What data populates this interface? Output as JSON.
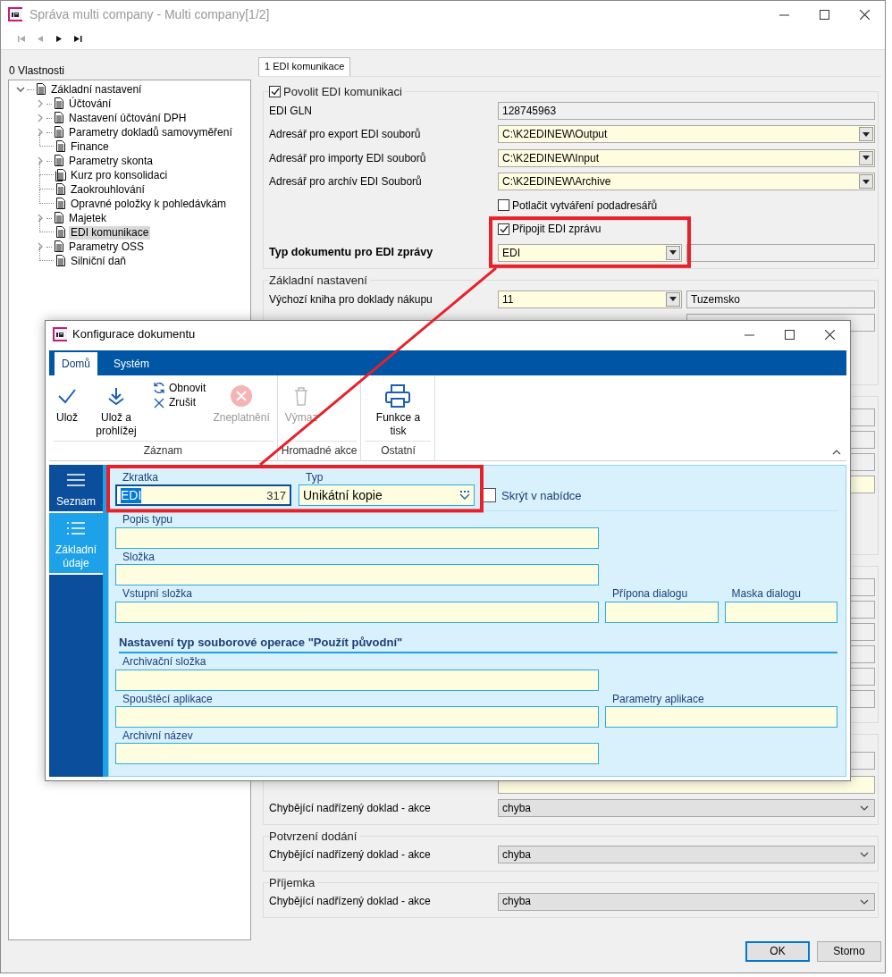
{
  "window": {
    "title": "Správa multi company - Multi company[1/2]"
  },
  "nav": [
    {
      "kind": "first",
      "disabled": true
    },
    {
      "kind": "prev",
      "disabled": true
    },
    {
      "kind": "next",
      "disabled": false
    },
    {
      "kind": "last",
      "disabled": false
    }
  ],
  "properties_label": "0 Vlastnosti",
  "tree": {
    "label": "Základní nastavení",
    "expanded": true,
    "children": [
      {
        "label": "Účtování",
        "kind": "group",
        "selected": false
      },
      {
        "label": "Nastavení účtování DPH",
        "kind": "group",
        "selected": false
      },
      {
        "label": "Parametry dokladů samovyměření",
        "kind": "group",
        "selected": false
      },
      {
        "label": "Finance",
        "kind": "leaf",
        "selected": false
      },
      {
        "label": "Parametry skonta",
        "kind": "group",
        "selected": false
      },
      {
        "label": "Kurz pro konsolidaci",
        "kind": "leaf-multi",
        "selected": false
      },
      {
        "label": "Zaokrouhlování",
        "kind": "leaf",
        "selected": false
      },
      {
        "label": "Opravné položky k pohledávkám",
        "kind": "leaf",
        "selected": false
      },
      {
        "label": "Majetek",
        "kind": "group",
        "selected": false
      },
      {
        "label": "EDI komunikace",
        "kind": "leaf",
        "selected": true
      },
      {
        "label": "Parametry OSS",
        "kind": "group",
        "selected": false
      },
      {
        "label": "Silniční daň",
        "kind": "leaf",
        "selected": false
      }
    ]
  },
  "tabs": [
    {
      "label": "1 EDI komunikace",
      "selected": true
    }
  ],
  "edi_group": {
    "label": "Povolit EDI komunikaci",
    "checked": true,
    "rows": [
      {
        "kind": "readonly",
        "label": "EDI GLN",
        "value": "128745963"
      },
      {
        "kind": "combo",
        "label": "Adresář pro export EDI souborů",
        "value": "C:\\K2EDINEW\\Output"
      },
      {
        "kind": "combo",
        "label": "Adresář pro importy EDI souborů",
        "value": "C:\\K2EDINEW\\Input"
      },
      {
        "kind": "combo",
        "label": "Adresář pro archív EDI Souborů",
        "value": "C:\\K2EDINEW\\Archive"
      },
      {
        "kind": "checkbox",
        "label": "Potlačit vytváření podadresářů",
        "checked": false
      },
      {
        "kind": "checkbox",
        "label": "Připojit EDI zprávu",
        "checked": true
      },
      {
        "kind": "combo-bold",
        "label": "Typ dokumentu pro EDI zprávy",
        "value": "EDI"
      }
    ]
  },
  "base_group": {
    "title": "Základní nastavení",
    "rows": [
      {
        "label": "Výchozí kniha pro doklady nákupu",
        "value": "11",
        "extra": "Tuzemsko"
      }
    ]
  },
  "lower_groups": [
    {
      "rows": [
        {
          "label": "Chybějící nadřízený doklad - akce",
          "value": "chyba"
        }
      ]
    },
    {
      "title": "Potvrzení dodání",
      "rows": [
        {
          "label": "Chybějící nadřízený doklad - akce",
          "value": "chyba"
        }
      ]
    },
    {
      "title": "Příjemka",
      "rows": [
        {
          "label": "Chybějící nadřízený doklad - akce",
          "value": "chyba"
        }
      ]
    }
  ],
  "buttons": [
    {
      "label": "OK",
      "default": true
    },
    {
      "label": "Storno",
      "default": false
    }
  ],
  "dialog": {
    "title": "Konfigurace dokumentu",
    "ribbon": {
      "tabs": [
        {
          "label": "Domů",
          "selected": true
        },
        {
          "label": "Systém",
          "selected": false
        }
      ],
      "groups": [
        {
          "label": "Záznam",
          "items": [
            {
              "kind": "large",
              "label": "Ulož",
              "disabled": false
            },
            {
              "kind": "large",
              "label": "Ulož a prohlížej",
              "disabled": false
            },
            {
              "kind": "small",
              "label": "Obnovit",
              "disabled": false
            },
            {
              "kind": "small",
              "label": "Zrušit",
              "disabled": false
            },
            {
              "kind": "large",
              "label": "Zneplatnění",
              "disabled": true
            }
          ]
        },
        {
          "label": "Hromadné akce",
          "items": [
            {
              "kind": "large",
              "label": "Výmaz",
              "disabled": true
            }
          ]
        },
        {
          "label": "Ostatní",
          "items": [
            {
              "kind": "large",
              "label": "Funkce a tisk",
              "disabled": false
            }
          ]
        }
      ]
    },
    "sidebar": [
      {
        "label": "Seznam",
        "selected": false
      },
      {
        "label": "Základní údaje",
        "selected": true
      }
    ],
    "form": {
      "head": [
        {
          "kind": "text",
          "label": "Zkratka",
          "value": "EDI",
          "counter": "317",
          "focused": true
        },
        {
          "kind": "combo",
          "label": "Typ",
          "value": "Unikátní kopie"
        },
        {
          "kind": "checkbox",
          "label": "Skrýt v nabídce",
          "checked": false
        }
      ],
      "sections": [
        {
          "rows": [
            [
              {
                "label": "Popis typu"
              }
            ],
            [
              {
                "label": "Složka"
              }
            ],
            [
              {
                "label": "Vstupní složka"
              },
              {
                "label": "Přípona dialogu"
              },
              {
                "label": "Maska dialogu"
              }
            ]
          ]
        },
        {
          "heading": "Nastavení typ souborové operace \"Použít původní\"",
          "rows": [
            [
              {
                "label": "Archivační složka"
              }
            ],
            [
              {
                "label": "Spouštěcí aplikace"
              },
              {
                "label": "Parametry aplikace"
              }
            ],
            [
              {
                "label": "Archivní název"
              }
            ]
          ]
        }
      ]
    }
  }
}
